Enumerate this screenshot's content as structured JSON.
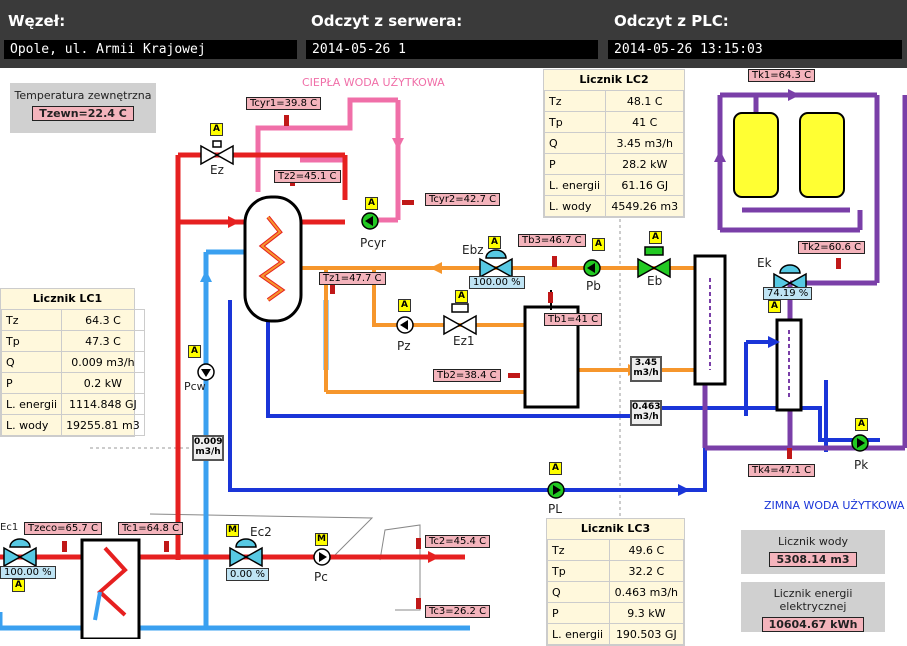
{
  "header": {
    "node_label": "Węzeł:",
    "node_value": "Opole, ul. Armii Krajowej",
    "server_label": "Odczyt z serwera:",
    "server_value": "2014-05-26 1",
    "plc_label": "Odczyt z PLC:",
    "plc_value": "2014-05-26 13:15:03"
  },
  "outdoor": {
    "title": "Temperatura zewnętrzna",
    "value": "Tzewn=22.4 C"
  },
  "zones": {
    "hot_water": "CIEPŁA WODA UŻYTKOWA",
    "cold_water": "ZIMNA WODA UŻYTKOWA"
  },
  "sensors": {
    "tcyr1": "Tcyr1=39.8 C",
    "tz2": "Tz2=45.1 C",
    "tcyr2": "Tcyr2=42.7 C",
    "tb3": "Tb3=46.7 C",
    "tz1": "Tz1=47.7 C",
    "tb1": "Tb1=41 C",
    "tb2": "Tb2=38.4 C",
    "tk1": "Tk1=64.3 C",
    "tk2": "Tk2=60.6 C",
    "tk4": "Tk4=47.1 C",
    "tzeco": "Tzeco=65.7 C",
    "tc1": "Tc1=64.8 C",
    "tc2": "Tc2=45.4 C",
    "tc3": "Tc3=26.2 C"
  },
  "devices": {
    "ez": "Ez",
    "pcyr": "Pcyr",
    "ebz": "Ebz",
    "pb": "Pb",
    "eb": "Eb",
    "ek": "Ek",
    "pz": "Pz",
    "ez1": "Ez1",
    "pcw": "Pcw",
    "pk": "Pk",
    "pl": "PL",
    "ec1": "Ec1",
    "ec2": "Ec2",
    "pc": "Pc"
  },
  "badges": {
    "auto": "A",
    "manual": "M"
  },
  "valve_positions": {
    "ebz": "100.00 %",
    "ek": "74.19 %",
    "ec1": "100.00 %",
    "ec2": "0.00 %"
  },
  "flows": {
    "f1": "3.45",
    "f2": "0.463",
    "f3": "0.009",
    "unit": "m3/h"
  },
  "meter_lc2": {
    "title": "Licznik LC2",
    "rows": [
      [
        "Tz",
        "48.1 C"
      ],
      [
        "Tp",
        "41 C"
      ],
      [
        "Q",
        "3.45 m3/h"
      ],
      [
        "P",
        "28.2 kW"
      ],
      [
        "L. energii",
        "61.16 GJ"
      ],
      [
        "L. wody",
        "4549.26 m3"
      ]
    ]
  },
  "meter_lc1": {
    "title": "Licznik LC1",
    "rows": [
      [
        "Tz",
        "64.3 C"
      ],
      [
        "Tp",
        "47.3 C"
      ],
      [
        "Q",
        "0.009 m3/h"
      ],
      [
        "P",
        "0.2 kW"
      ],
      [
        "L. energii",
        "1114.848 GJ"
      ],
      [
        "L. wody",
        "19255.81 m3"
      ]
    ]
  },
  "meter_lc3": {
    "title": "Licznik LC3",
    "rows": [
      [
        "Tz",
        "49.6 C"
      ],
      [
        "Tp",
        "32.2 C"
      ],
      [
        "Q",
        "0.463 m3/h"
      ],
      [
        "P",
        "9.3 kW"
      ],
      [
        "L. energii",
        "190.503 GJ"
      ]
    ]
  },
  "water_meter": {
    "title": "Licznik wody",
    "value": "5308.14 m3"
  },
  "energy_meter": {
    "title": "Licznik energii elektrycznej",
    "value": "10604.67 kWh"
  }
}
